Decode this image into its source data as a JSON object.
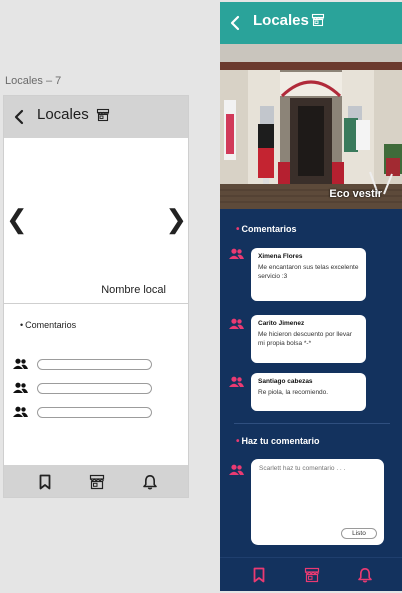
{
  "frame_label": "Locales – 7",
  "wireframe": {
    "title": "Locales",
    "nav_prev": "❮",
    "nav_next": "❯",
    "local_name": "Nombre local",
    "comments_heading": "Comentarios",
    "rows": 3
  },
  "app": {
    "title": "Locales",
    "photo_caption": "Eco vestir",
    "comments_heading": "Comentarios",
    "comments": [
      {
        "name": "Ximena Flores",
        "text": "Me encantaron sus telas excelente servicio :3"
      },
      {
        "name": "Carito Jimenez",
        "text": "Me hicieron descuento por llevar mi propia bolsa *-*"
      },
      {
        "name": "Santiago cabezas",
        "text": "Re piola, la recomiendo."
      }
    ],
    "compose_heading": "Haz tu comentario",
    "compose_placeholder": "Scarlett haz tu comentario . . .",
    "compose_button": "Listo"
  },
  "colors": {
    "teal": "#2aa39a",
    "navy": "#13325e",
    "pink": "#ea3a72"
  },
  "icons": {
    "back": "back-arrow-icon",
    "store": "store-icon",
    "people": "people-icon",
    "bookmark": "bookmark-icon",
    "bell": "bell-icon"
  }
}
